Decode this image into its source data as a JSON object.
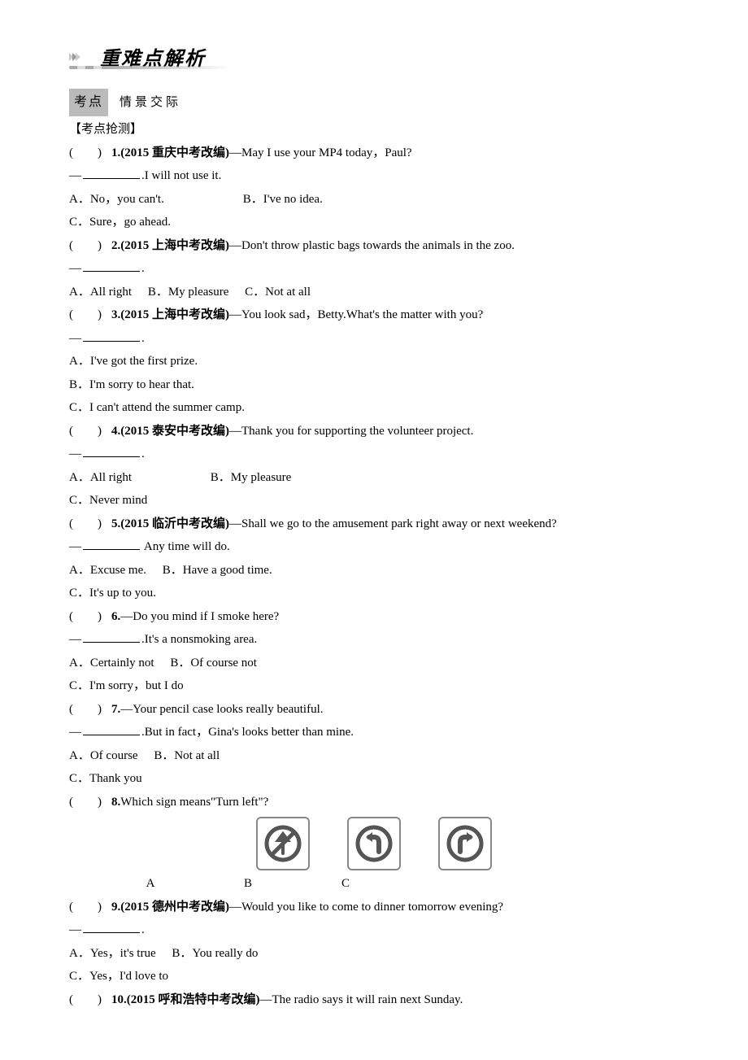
{
  "header": {
    "title": "重难点解析",
    "tag": "考点",
    "tag_text": "情景交际",
    "sub_heading": "【考点抢测】"
  },
  "questions": [
    {
      "num": "1.",
      "src": "(2015 重庆中考改编)",
      "prompt_a": "—May I use your MP4 today，Paul?",
      "prompt_b": "—________.I will not use it.",
      "options": [
        "A．No，you can't.",
        "B．I've no idea.",
        "C．Sure，go ahead."
      ],
      "opt_layout": "two-then-one"
    },
    {
      "num": "2.",
      "src": "(2015 上海中考改编)",
      "prompt_a": "—Don't throw plastic bags towards the animals in the zoo.",
      "prompt_b": "—________.",
      "options": [
        "A．All right",
        "B．My pleasure",
        "C．Not at all"
      ],
      "opt_layout": "one-line"
    },
    {
      "num": "3.",
      "src": "(2015 上海中考改编)",
      "prompt_a": "—You look sad，Betty.What's the matter with you?",
      "prompt_b": "—________.",
      "options": [
        "A．I've got the first prize.",
        "B．I'm sorry to hear that.",
        "C．I can't attend the summer camp."
      ],
      "opt_layout": "each-line"
    },
    {
      "num": "4.",
      "src": "(2015 泰安中考改编)",
      "prompt_a": "—Thank you for supporting the volunteer project.",
      "prompt_b": "—________.",
      "options": [
        "A．All right",
        "B．My pleasure",
        "C．Never mind"
      ],
      "opt_layout": "two-then-one"
    },
    {
      "num": "5.",
      "src": "(2015 临沂中考改编)",
      "prompt_a": "—Shall we go to the amusement park right away or next weekend?",
      "prompt_b": "—________ Any time will do.",
      "options": [
        "A．Excuse me.",
        "B．Have a good time.",
        "C．It's up to you."
      ],
      "opt_layout": "two-then-one"
    },
    {
      "num": "6.",
      "src": "",
      "prompt_a": "—Do you mind if I smoke here?",
      "prompt_b": "—________.It's a non­smoking area.",
      "options": [
        "A．Certainly not",
        "B．Of course not",
        "C．I'm sorry，but I do"
      ],
      "opt_layout": "two-then-one"
    },
    {
      "num": "7.",
      "src": "",
      "prompt_a": "—Your pencil case looks really beautiful.",
      "prompt_b": "—________.But in fact，Gina's looks better than mine.",
      "options": [
        "A．Of course",
        "B．Not at all",
        "C．Thank you"
      ],
      "opt_layout": "two-then-one"
    },
    {
      "num": "8.",
      "src": "",
      "prompt_a": "Which sign means\"Turn left\"?",
      "sign_labels": [
        "A",
        "B",
        "C"
      ]
    },
    {
      "num": "9.",
      "src": "(2015 德州中考改编)",
      "prompt_a": "—Would you like to come to dinner tomorrow evening?",
      "prompt_b": "—________.",
      "options": [
        "A．Yes，it's true",
        "B．You really do",
        "C．Yes，I'd love to"
      ],
      "opt_layout": "two-then-one"
    },
    {
      "num": "10.",
      "src": "(2015 呼和浩特中考改编)",
      "prompt_a": "—The radio says it will rain next Sunday."
    }
  ]
}
